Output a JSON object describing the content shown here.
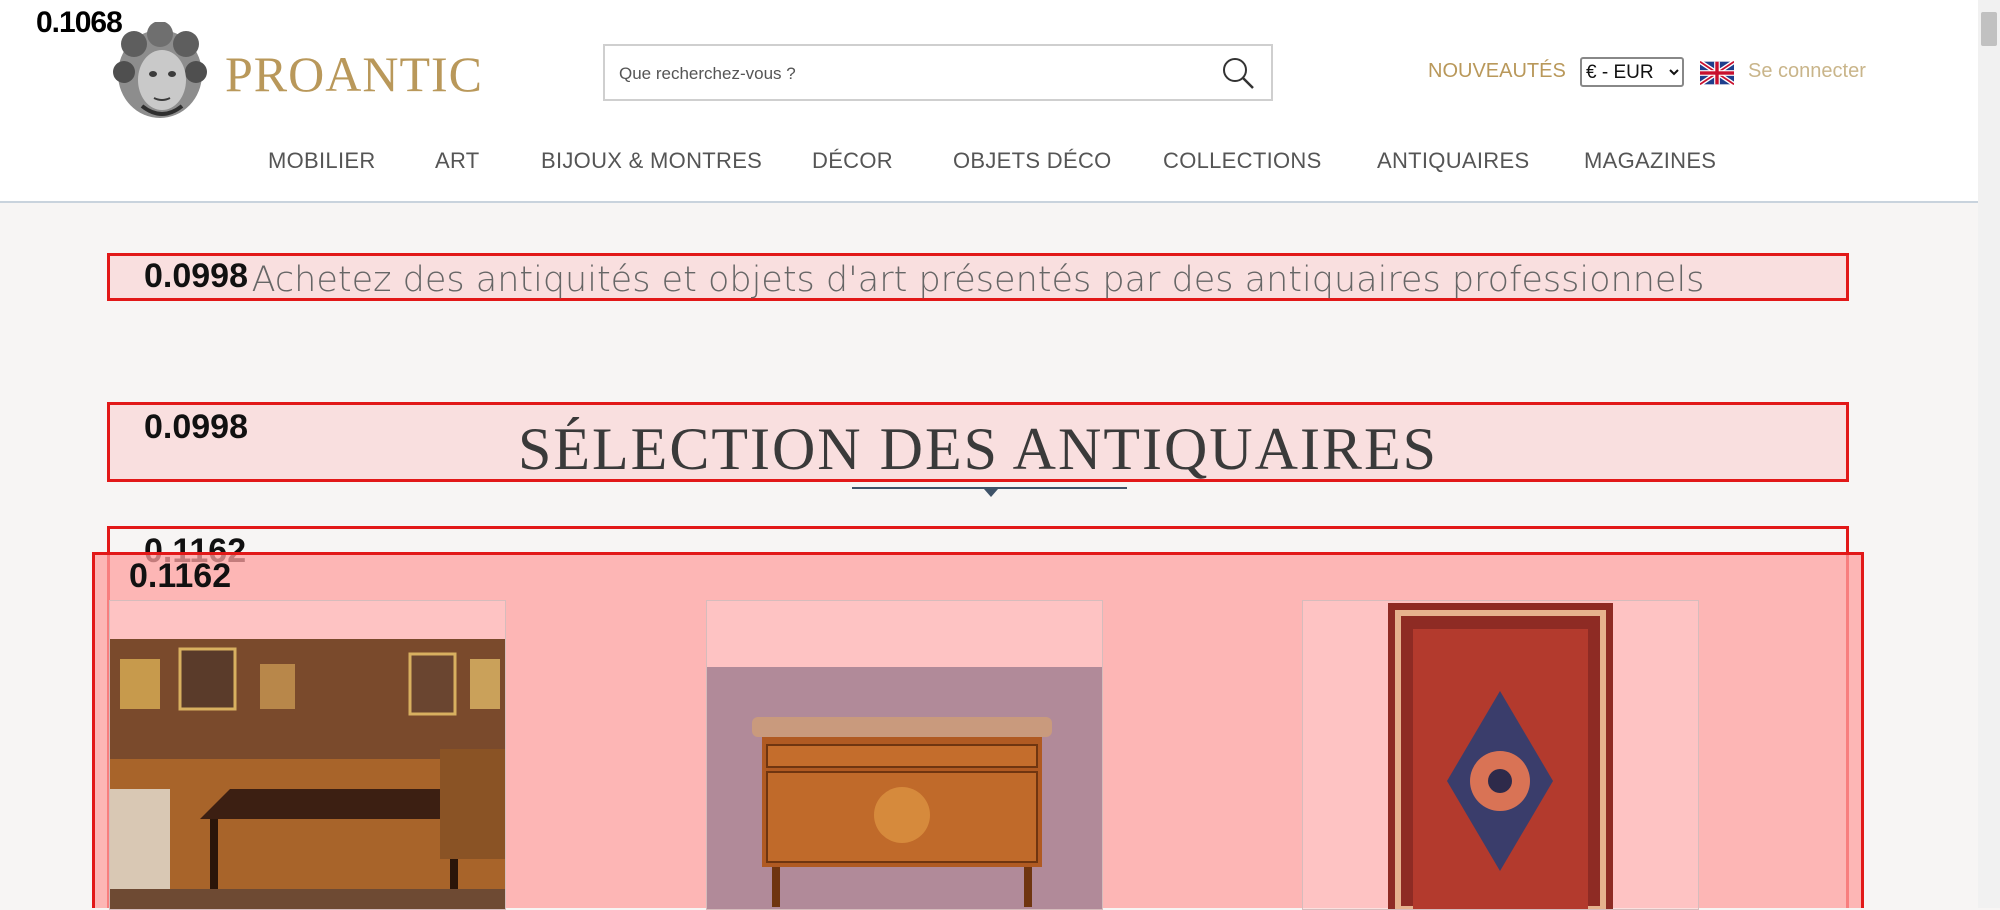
{
  "header": {
    "brand": "PROANTIC",
    "search_placeholder": "Que recherchez-vous ?",
    "new_link": "NOUVEAUTÉS",
    "currency": "€ - EUR",
    "currency_options": [
      "€ - EUR"
    ],
    "login": "Se connecter"
  },
  "nav": {
    "items": [
      "MOBILIER",
      "ART",
      "BIJOUX & MONTRES",
      "DÉCOR",
      "OBJETS DÉCO",
      "COLLECTIONS",
      "ANTIQUAIRES",
      "MAGAZINES"
    ]
  },
  "overlay": {
    "corner_label": "0.1068",
    "tagline_score": "0.0998",
    "section_score": "0.0998",
    "grid_score_outer": "0.1162",
    "grid_score_inner": "0.1162"
  },
  "content": {
    "tagline": "Achetez des antiquités et objets d'art présentés par des antiquaires professionnels",
    "section_title": "SÉLECTION DES ANTIQUAIRES"
  },
  "colors": {
    "gold": "#b9985a",
    "highlight_border": "#e21818",
    "divider": "#3e5268"
  },
  "icons": {
    "search": "search-icon",
    "flag": "uk-flag-icon",
    "logo": "medusa-head-logo"
  }
}
